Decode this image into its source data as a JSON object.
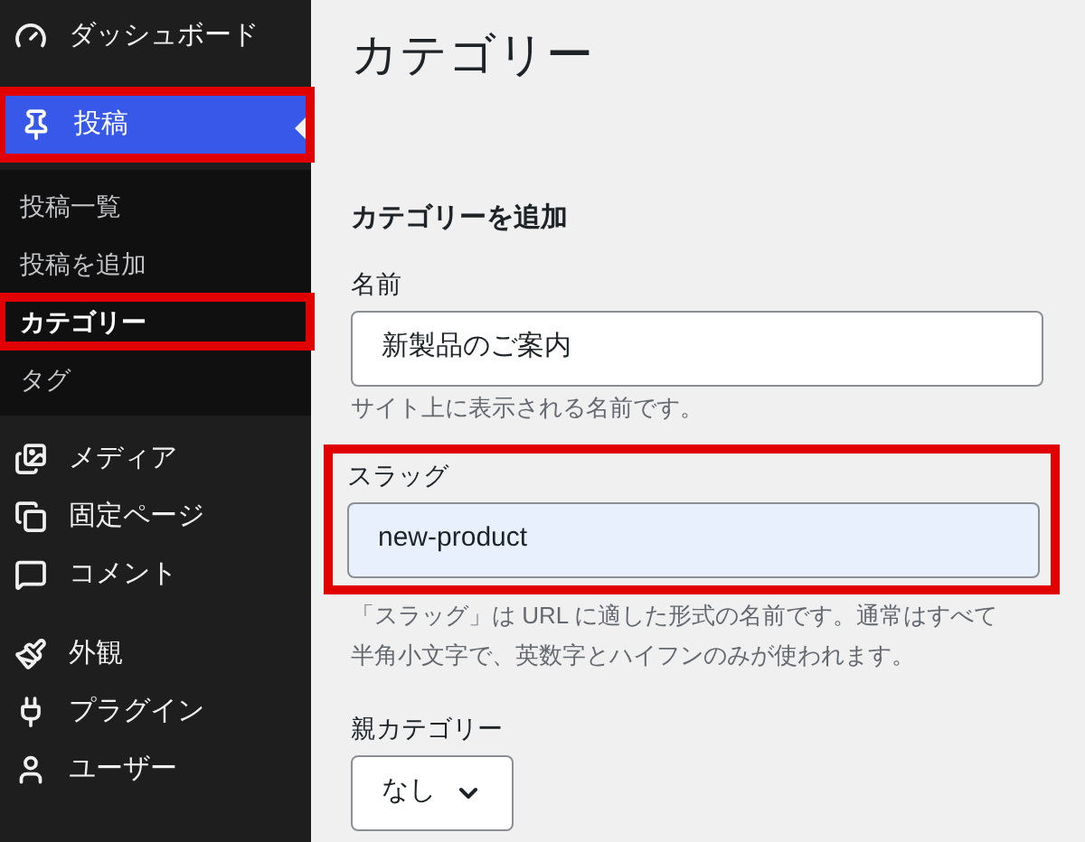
{
  "sidebar": {
    "items": [
      {
        "label": "ダッシュボード",
        "selected": false,
        "highlighted": false
      },
      {
        "label": "投稿",
        "selected": true,
        "highlighted": true,
        "children": [
          {
            "label": "投稿一覧",
            "selected": false,
            "highlighted": false
          },
          {
            "label": "投稿を追加",
            "selected": false,
            "highlighted": false
          },
          {
            "label": "カテゴリー",
            "selected": true,
            "highlighted": true
          },
          {
            "label": "タグ",
            "selected": false,
            "highlighted": false
          }
        ]
      },
      {
        "label": "メディア",
        "selected": false,
        "highlighted": false
      },
      {
        "label": "固定ページ",
        "selected": false,
        "highlighted": false
      },
      {
        "label": "コメント",
        "selected": false,
        "highlighted": false
      },
      {
        "label": "外観",
        "selected": false,
        "highlighted": false
      },
      {
        "label": "プラグイン",
        "selected": false,
        "highlighted": false
      },
      {
        "label": "ユーザー",
        "selected": false,
        "highlighted": false
      }
    ]
  },
  "page_title": "カテゴリー",
  "form": {
    "heading": "カテゴリーを追加",
    "fields": [
      {
        "kind": "text",
        "label": "名前",
        "value": "新製品のご案内",
        "hints": [
          "サイト上に表示される名前です。"
        ]
      },
      {
        "kind": "text",
        "label": "スラッグ",
        "value": "new-product",
        "autofilled": true,
        "highlighted": true,
        "hints": [
          "「スラッグ」は URL に適した形式の名前です。通常はすべて",
          "半角小文字で、英数字とハイフンのみが使われます。"
        ]
      },
      {
        "kind": "select",
        "label": "親カテゴリー",
        "value": "なし"
      }
    ]
  }
}
